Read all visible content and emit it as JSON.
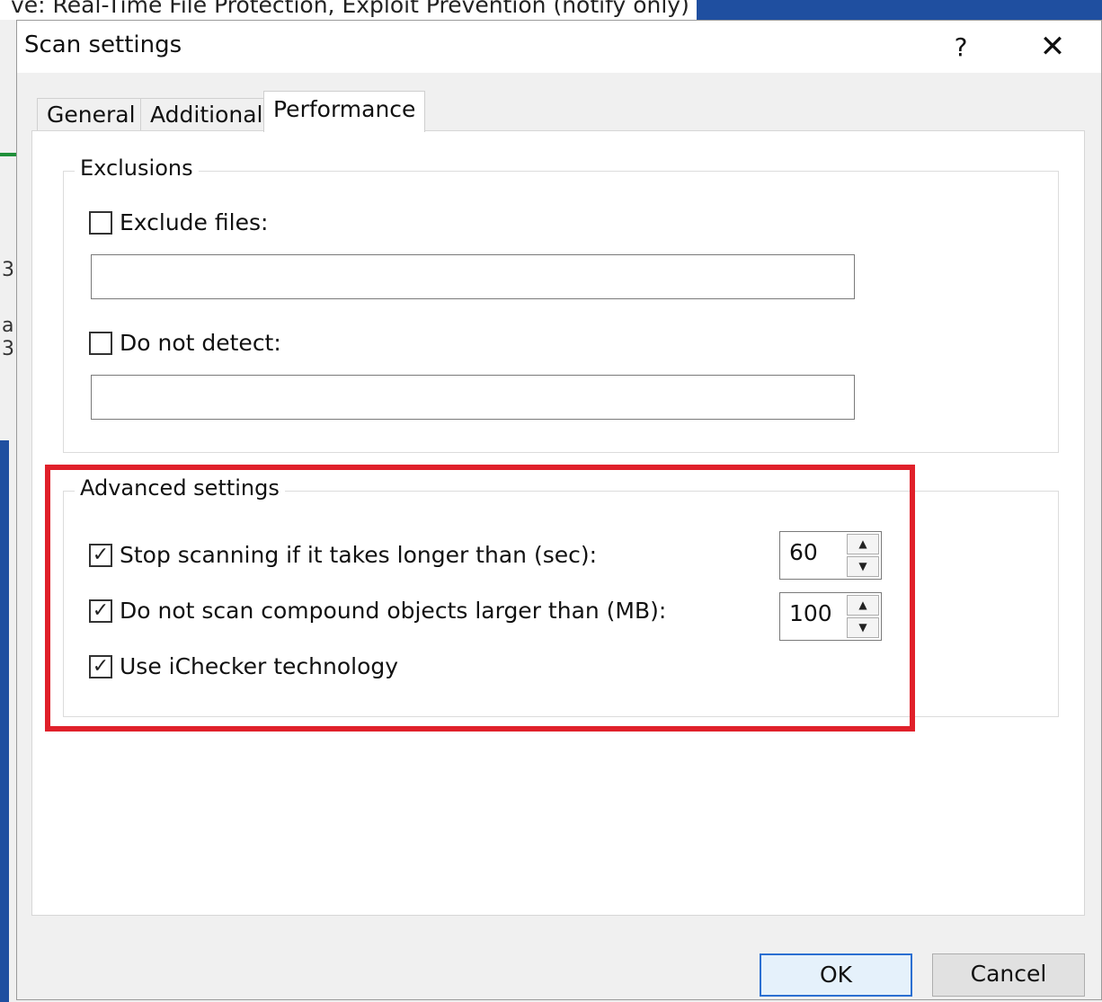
{
  "background": {
    "title_fragment": "ve: Real-Time File Protection, Exploit Prevention (notify only)",
    "fragments": [
      "3",
      "a",
      "3:"
    ]
  },
  "dialog": {
    "title": "Scan settings",
    "help_glyph": "?",
    "close_glyph": "✕"
  },
  "tabs": [
    {
      "label": "General",
      "active": false
    },
    {
      "label": "Additional",
      "active": false
    },
    {
      "label": "Performance",
      "active": true
    }
  ],
  "exclusions": {
    "legend": "Exclusions",
    "exclude_files": {
      "label": "Exclude files:",
      "checked": false,
      "value": ""
    },
    "do_not_detect": {
      "label": "Do not detect:",
      "checked": false,
      "value": ""
    }
  },
  "advanced": {
    "legend": "Advanced settings",
    "stop_scanning": {
      "label": "Stop scanning if it takes longer than (sec):",
      "checked": true,
      "value": "60"
    },
    "compound": {
      "label": "Do not scan compound objects larger than (MB):",
      "checked": true,
      "value": "100"
    },
    "ichecker": {
      "label": "Use iChecker technology",
      "checked": true
    }
  },
  "icons": {
    "check": "✓",
    "spin_up": "▲",
    "spin_down": "▼"
  },
  "highlight_color": "#e0202a",
  "buttons": {
    "ok": "OK",
    "cancel": "Cancel"
  }
}
